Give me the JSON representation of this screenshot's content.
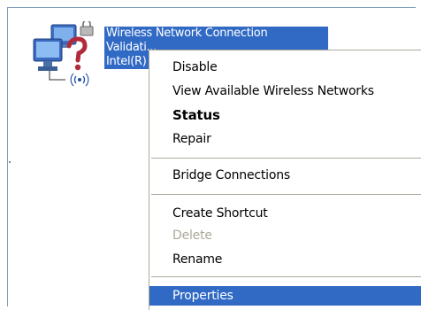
{
  "connection": {
    "name": "Wireless Network Connection",
    "status": "Validati...",
    "adapter": "Intel(R)"
  },
  "context_menu": {
    "items": [
      {
        "label": "Disable",
        "enabled": true,
        "bold": false
      },
      {
        "label": "View Available Wireless Networks",
        "enabled": true,
        "bold": false
      },
      {
        "label": "Status",
        "enabled": true,
        "bold": true
      },
      {
        "label": "Repair",
        "enabled": true,
        "bold": false
      },
      {
        "label": "Bridge Connections",
        "enabled": true,
        "bold": false
      },
      {
        "label": "Create Shortcut",
        "enabled": true,
        "bold": false
      },
      {
        "label": "Delete",
        "enabled": false,
        "bold": false
      },
      {
        "label": "Rename",
        "enabled": true,
        "bold": false
      },
      {
        "label": "Properties",
        "enabled": true,
        "bold": false,
        "highlighted": true
      }
    ]
  },
  "colors": {
    "selection": "#316ac5",
    "separator": "#aca899",
    "disabled_text": "#aca899",
    "pane_border": "#7f9db9"
  },
  "icons": {
    "connection": "wireless-network-connection-icon",
    "lock": "lock-icon",
    "unknown_status": "question-mark-icon",
    "signal": "wireless-signal-icon"
  }
}
